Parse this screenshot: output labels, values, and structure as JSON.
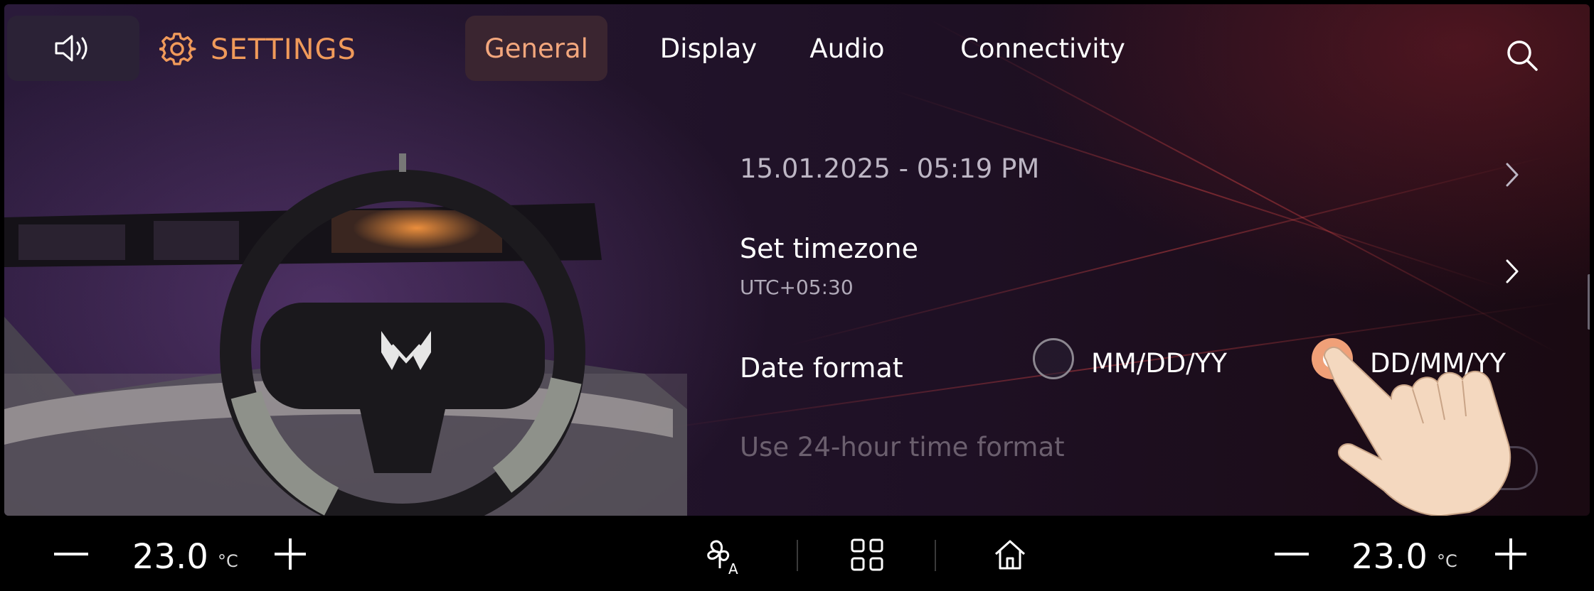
{
  "header": {
    "title": "SETTINGS",
    "tabs": [
      {
        "label": "General",
        "active": true
      },
      {
        "label": "Display",
        "active": false
      },
      {
        "label": "Audio",
        "active": false
      },
      {
        "label": "Connectivity",
        "active": false
      }
    ]
  },
  "settings": {
    "datetime": "15.01.2025 - 05:19 PM",
    "timezone": {
      "title": "Set timezone",
      "value": "UTC+05:30"
    },
    "date_format": {
      "label": "Date format",
      "options": [
        "MM/DD/YY",
        "DD/MM/YY"
      ],
      "selected": "DD/MM/YY"
    },
    "time_format_24h": {
      "label": "Use 24-hour time format",
      "enabled": false
    }
  },
  "climate": {
    "left": {
      "temp": "23.0",
      "unit": "°C"
    },
    "right": {
      "temp": "23.0",
      "unit": "°C"
    }
  },
  "colors": {
    "accent": "#f09a5a",
    "active_tab_bg": "#3a2530"
  },
  "icons": [
    "volume-icon",
    "gear-icon",
    "search-icon",
    "chevron-right-icon",
    "fan-auto-icon",
    "apps-grid-icon",
    "home-icon",
    "minus-icon",
    "plus-icon"
  ]
}
